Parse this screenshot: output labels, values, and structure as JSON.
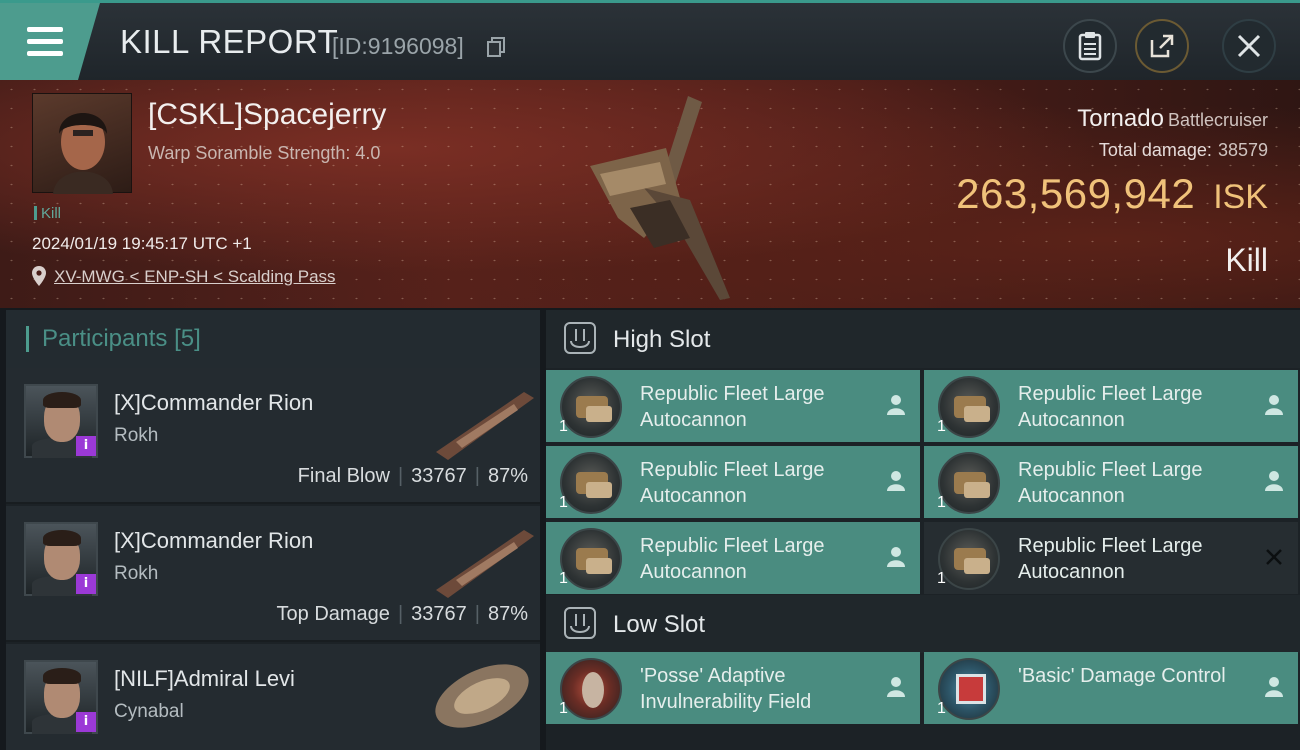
{
  "header": {
    "title": "KILL REPORT",
    "report_id": "[ID:9196098]"
  },
  "victim": {
    "name": "[CSKL]Spacejerry",
    "scramble": "Warp Soramble Strength: 4.0",
    "kill_tag": "Kill",
    "timestamp": "2024/01/19 19:45:17 UTC +1",
    "location": "XV-MWG < ENP-SH < Scalding Pass",
    "ship_name": "Tornado",
    "ship_class": "Battlecruiser",
    "total_damage_label": "Total damage:",
    "total_damage": "38579",
    "isk_value": "263,569,942",
    "isk_unit": "ISK",
    "result": "Kill"
  },
  "participants": {
    "title": "Participants",
    "count": "[5]",
    "items": [
      {
        "name": "[X]Commander Rion",
        "ship": "Rokh",
        "label": "Final Blow",
        "damage": "33767",
        "percent": "87%"
      },
      {
        "name": "[X]Commander Rion",
        "ship": "Rokh",
        "label": "Top Damage",
        "damage": "33767",
        "percent": "87%"
      },
      {
        "name": "[NILF]Admiral Levi",
        "ship": "Cynabal"
      }
    ]
  },
  "fittings": {
    "high_slot": {
      "title": "High Slot",
      "modules": [
        {
          "name": "Republic Fleet Large Autocannon",
          "qty": "1",
          "state": "dropped"
        },
        {
          "name": "Republic Fleet Large Autocannon",
          "qty": "1",
          "state": "dropped"
        },
        {
          "name": "Republic Fleet Large Autocannon",
          "qty": "1",
          "state": "dropped"
        },
        {
          "name": "Republic Fleet Large Autocannon",
          "qty": "1",
          "state": "dropped"
        },
        {
          "name": "Republic Fleet Large Autocannon",
          "qty": "1",
          "state": "dropped"
        },
        {
          "name": "Republic Fleet Large Autocannon",
          "qty": "1",
          "state": "destroyed"
        }
      ]
    },
    "low_slot": {
      "title": "Low Slot",
      "modules": [
        {
          "name": "'Posse' Adaptive Invulnerability Field",
          "qty": "1",
          "state": "dropped"
        },
        {
          "name": "'Basic' Damage Control",
          "qty": "1",
          "state": "dropped"
        }
      ]
    }
  },
  "colors": {
    "accent": "#4d9c8e",
    "isk": "#f0c27a",
    "module_dropped": "#4a8c80",
    "module_destroyed": "#262d31",
    "alpha_badge": "#9b39d6"
  },
  "icons": {
    "menu": "hamburger-icon",
    "copy": "copy-icon",
    "clipboard": "clipboard-icon",
    "share": "share-icon",
    "close": "close-icon",
    "location": "location-pin-icon",
    "pilot": "person-icon",
    "destroyed": "x-icon"
  }
}
